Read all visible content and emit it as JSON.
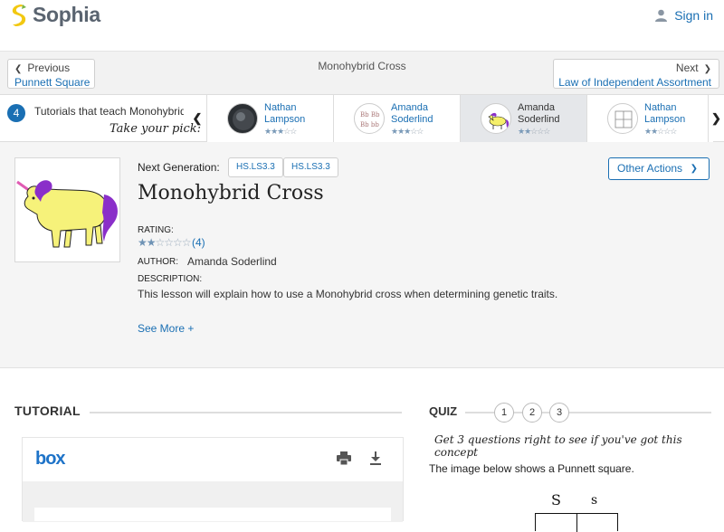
{
  "header": {
    "brand": "Sophia",
    "signin": "Sign in"
  },
  "nav": {
    "prev_small": "Previous",
    "prev_link": "Punnett Square",
    "current": "Monohybrid Cross",
    "next_small": "Next",
    "next_link": "Law of Independent Assortment"
  },
  "tutorials": {
    "count": "4",
    "label": "Tutorials that teach Monohybrid Cross",
    "take_pick": "Take your pick:",
    "cards": [
      {
        "author_first": "Nathan",
        "author_last": "Lampson",
        "rating": 3.5
      },
      {
        "author_first": "Amanda",
        "author_last": "Soderlind",
        "rating": 3.5
      },
      {
        "author_first": "Amanda",
        "author_last": "Soderlind",
        "rating": 2
      },
      {
        "author_first": "Nathan",
        "author_last": "Lampson",
        "rating": 2
      }
    ]
  },
  "lesson": {
    "next_gen_label": "Next Generation:",
    "tags": [
      "HS.LS3.3",
      "HS.LS3.3"
    ],
    "other_actions": "Other Actions",
    "title": "Monohybrid Cross",
    "rating_label": "RATING:",
    "rating_value": 2,
    "rating_count": "(4)",
    "author_label": "AUTHOR:",
    "author": "Amanda Soderlind",
    "description_label": "DESCRIPTION:",
    "description": "This lesson will explain how to use a Monohybrid cross when determining genetic traits.",
    "see_more": "See More +"
  },
  "tutorial_section": {
    "heading": "TUTORIAL",
    "viewer_brand": "box"
  },
  "quiz": {
    "heading": "QUIZ",
    "numbers": [
      "1",
      "2",
      "3"
    ],
    "message": "Get 3 questions right to see if you've got this concept",
    "question": "The image below shows a Punnett square.",
    "punnett_top": [
      "S",
      "s"
    ]
  },
  "colors": {
    "link": "#1a6fb3",
    "brand_green": "#f2c811",
    "panel": "#f5f5f5"
  }
}
